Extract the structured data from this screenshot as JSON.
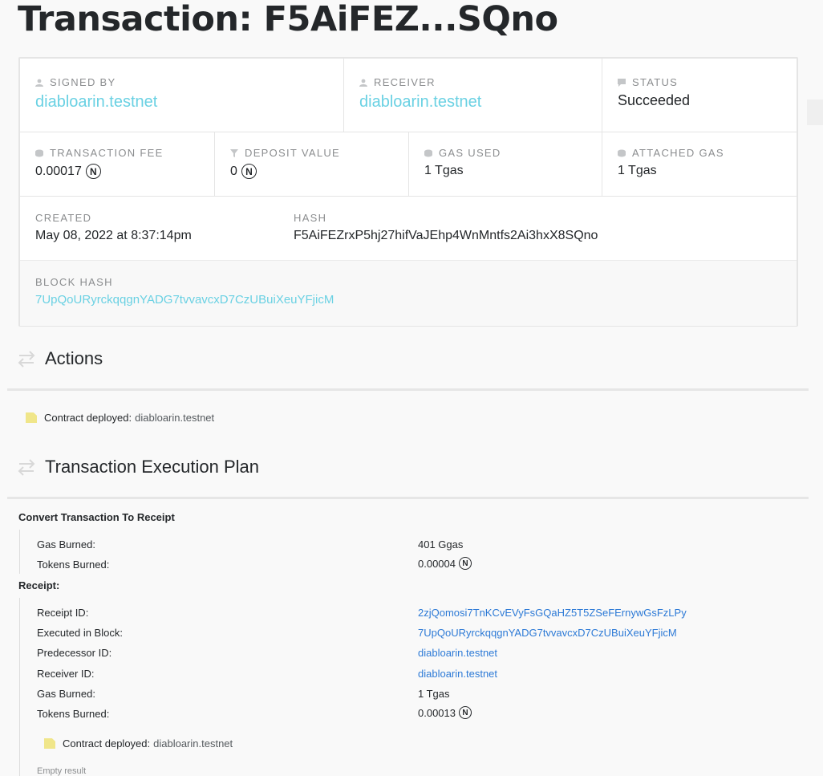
{
  "page": {
    "title": "Transaction: F5AiFEZ...SQno"
  },
  "summary": {
    "signed_by": {
      "label": "SIGNED BY",
      "value": "diabloarin.testnet",
      "icon": "user-icon"
    },
    "receiver": {
      "label": "RECEIVER",
      "value": "diabloarin.testnet",
      "icon": "user-icon"
    },
    "status": {
      "label": "STATUS",
      "value": "Succeeded",
      "icon": "comment-icon"
    },
    "transaction_fee": {
      "label": "TRANSACTION FEE",
      "value": "0.00017",
      "icon": "coins-icon"
    },
    "deposit_value": {
      "label": "DEPOSIT VALUE",
      "value": "0",
      "icon": "filter-icon"
    },
    "gas_used": {
      "label": "GAS USED",
      "value": "1 Tgas",
      "icon": "coins-icon"
    },
    "attached_gas": {
      "label": "ATTACHED GAS",
      "value": "1 Tgas",
      "icon": "coins-icon"
    },
    "created": {
      "label": "CREATED",
      "value": "May 08, 2022 at 8:37:14pm"
    },
    "hash": {
      "label": "HASH",
      "value": "F5AiFEZrxP5hj27hifVaJEhp4WnMntfs2Ai3hxX8SQno"
    },
    "block_hash": {
      "label": "BLOCK HASH",
      "value": "7UpQoURyrckqqgnYADG7tvvavcxD7CzUBuiXeuYFjicM"
    },
    "near_symbol": "N"
  },
  "actions": {
    "title": "Actions",
    "items": [
      {
        "label": "Contract deployed:",
        "target": "diabloarin.testnet"
      }
    ]
  },
  "execution_plan": {
    "title": "Transaction Execution Plan",
    "convert": {
      "title": "Convert Transaction To Receipt",
      "gas_burned_label": "Gas Burned:",
      "gas_burned_value": "401 Ggas",
      "tokens_burned_label": "Tokens Burned:",
      "tokens_burned_value": "0.00004"
    },
    "receipt": {
      "title": "Receipt:",
      "receipt_id_label": "Receipt ID:",
      "receipt_id_value": "2zjQomosi7TnKCvEVyFsGQaHZ5T5ZSeFErnywGsFzLPy",
      "executed_block_label": "Executed in Block:",
      "executed_block_value": "7UpQoURyrckqqgnYADG7tvvavcxD7CzUBuiXeuYFjicM",
      "predecessor_label": "Predecessor ID:",
      "predecessor_value": "diabloarin.testnet",
      "receiver_label": "Receiver ID:",
      "receiver_value": "diabloarin.testnet",
      "gas_burned_label": "Gas Burned:",
      "gas_burned_value": "1 Tgas",
      "tokens_burned_label": "Tokens Burned:",
      "tokens_burned_value": "0.00013",
      "action_label": "Contract deployed:",
      "action_target": "diabloarin.testnet",
      "result": "Empty result"
    }
  }
}
